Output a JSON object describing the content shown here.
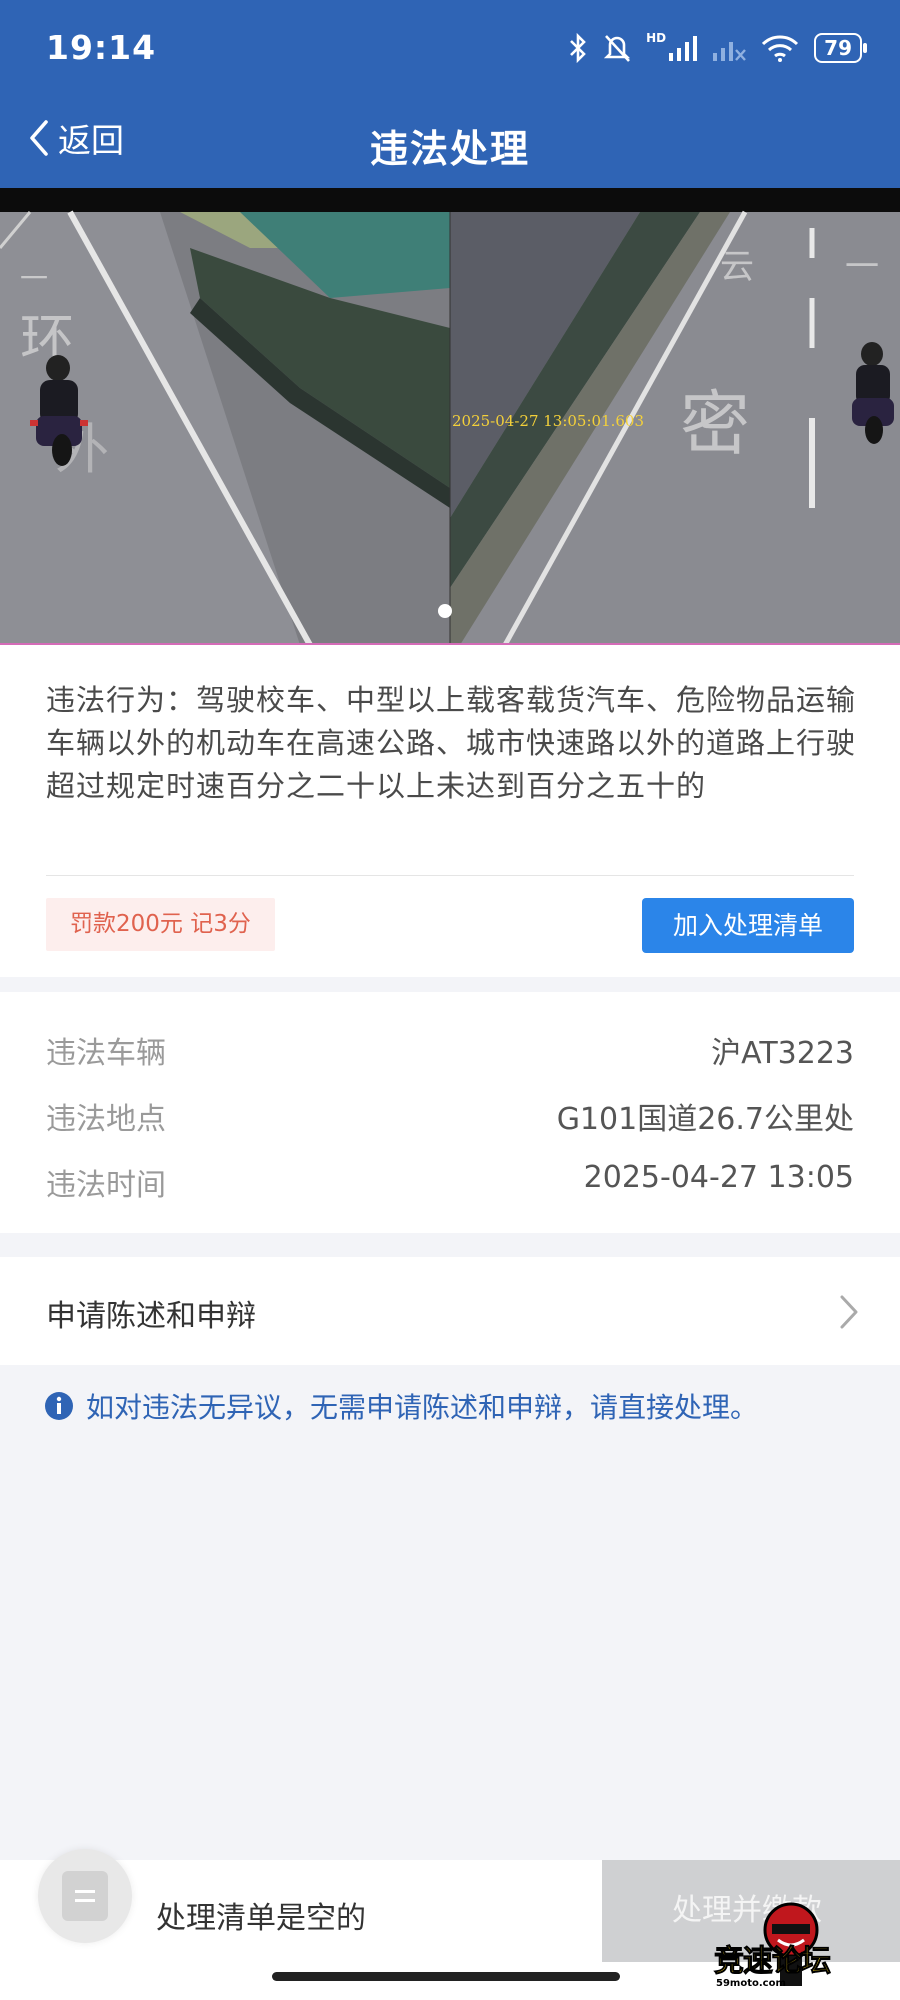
{
  "status_bar": {
    "time": "19:14",
    "hd": "HD",
    "battery": "79"
  },
  "nav": {
    "back_label": "返回",
    "title": "违法处理"
  },
  "photo": {
    "timestamp": "2025-04-27 13:05:01.603",
    "page_index": 1,
    "page_count": 1
  },
  "violation": {
    "description": "违法行为：驾驶校车、中型以上载客载货汽车、危险物品运输车辆以外的机动车在高速公路、城市快速路以外的道路上行驶超过规定时速百分之二十以上未达到百分之五十的",
    "fine_tag": "罚款200元 记3分",
    "add_button": "加入处理清单"
  },
  "details": [
    {
      "label": "违法车辆",
      "value": "沪AT3223"
    },
    {
      "label": "违法地点",
      "value": "G101国道26.7公里处"
    },
    {
      "label": "违法时间",
      "value": "2025-04-27 13:05"
    }
  ],
  "appeal": {
    "label": "申请陈述和申辩"
  },
  "notice": {
    "text": "如对违法无异议，无需申请陈述和申辩，请直接处理。"
  },
  "bottom_bar": {
    "empty_label": "处理清单是空的",
    "pay_button": "处理并缴款"
  },
  "watermark": {
    "text": "竞速论坛",
    "sub": "59moto.com"
  },
  "colors": {
    "header": "#2f64b5",
    "primary_button": "#2b85e9",
    "fine_text": "#e0624e",
    "fine_bg": "#fdeeed",
    "notice": "#2f64b5"
  }
}
